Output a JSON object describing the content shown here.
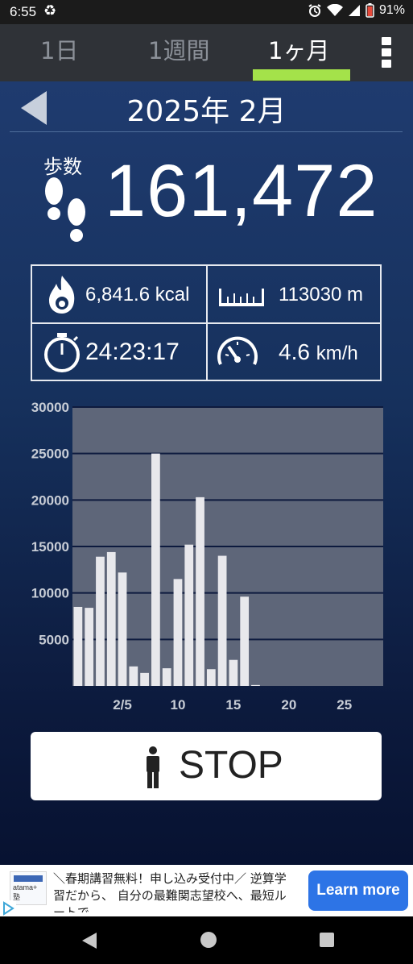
{
  "status_bar": {
    "time": "6:55",
    "battery": "91%"
  },
  "tabs": [
    {
      "label": "1日",
      "active": false
    },
    {
      "label": "1週間",
      "active": false
    },
    {
      "label": "1ヶ月",
      "active": true
    }
  ],
  "header": {
    "month_title": "2025年 2月"
  },
  "steps": {
    "label": "歩数",
    "value": "161,472"
  },
  "stats": {
    "calories": {
      "value": "6,841.6",
      "unit": "kcal"
    },
    "distance": {
      "value": "113030",
      "unit": "m"
    },
    "duration": {
      "value": "24:23:17"
    },
    "speed": {
      "value": "4.6",
      "unit": "km/h"
    }
  },
  "chart_data": {
    "type": "bar",
    "x": [
      1,
      2,
      3,
      4,
      5,
      6,
      7,
      8,
      9,
      10,
      11,
      12,
      13,
      14,
      15,
      16,
      17,
      18,
      19,
      20,
      21,
      22,
      23,
      24,
      25,
      26,
      27,
      28
    ],
    "values": [
      8500,
      8400,
      13900,
      14400,
      12200,
      2100,
      1400,
      25000,
      1900,
      11500,
      15200,
      20300,
      1800,
      14000,
      2800,
      9600,
      100,
      0,
      0,
      0,
      0,
      0,
      0,
      0,
      0,
      0,
      0,
      0
    ],
    "x_tick_labels": [
      {
        "x": 5,
        "label": "2/5"
      },
      {
        "x": 10,
        "label": "10"
      },
      {
        "x": 15,
        "label": "15"
      },
      {
        "x": 20,
        "label": "20"
      },
      {
        "x": 25,
        "label": "25"
      }
    ],
    "y_ticks": [
      "30000",
      "25000",
      "20000",
      "15000",
      "10000",
      "5000"
    ],
    "ylim": [
      0,
      30000
    ],
    "grid": true,
    "colors": {
      "bar": "#e8e8ec",
      "plot_bg": "#5e6679",
      "grid": "#0d1a3e"
    }
  },
  "stop_button": {
    "label": "STOP"
  },
  "ad": {
    "thumb_label": "atama+ 塾",
    "text": "＼春期講習無料！申し込み受付中／ 逆算学習だから、 自分の最難関志望校へ、最短ルートで。",
    "button": "Learn more"
  }
}
